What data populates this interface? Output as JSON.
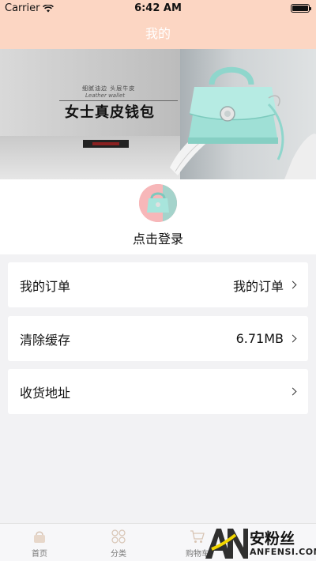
{
  "status_bar": {
    "carrier": "Carrier",
    "time": "6:42 AM"
  },
  "nav": {
    "title": "我的"
  },
  "banner": {
    "caption": "细腻油边  头层牛皮",
    "subcaption": "Leather wallet",
    "title": "女士真皮钱包"
  },
  "profile": {
    "login_text": "点击登录"
  },
  "menu": [
    {
      "label": "我的订单",
      "value": "我的订单"
    },
    {
      "label": "清除缓存",
      "value": "6.71MB"
    },
    {
      "label": "收货地址",
      "value": ""
    }
  ],
  "tabs": [
    {
      "label": "首页",
      "icon": "home-bag-icon"
    },
    {
      "label": "分类",
      "icon": "category-grid-icon"
    },
    {
      "label": "购物车",
      "icon": "cart-icon"
    },
    {
      "label": "",
      "icon": ""
    }
  ],
  "watermark": {
    "brand": "AN",
    "name_cn": "安粉丝",
    "name_en": "ANFENSI.COM"
  },
  "colors": {
    "header_bg": "#fcd6c3",
    "page_bg": "#f2f2f4",
    "tab_bg": "#f7f7f9"
  }
}
